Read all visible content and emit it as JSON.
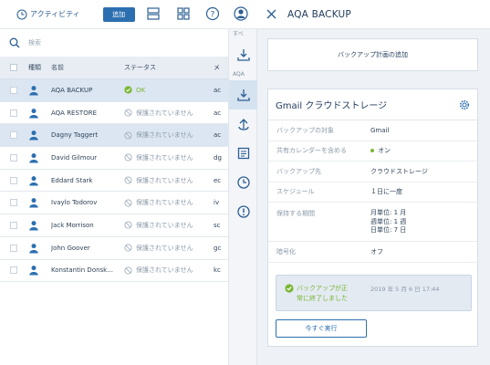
{
  "toolbar": {
    "activity_label": "アクティビティ",
    "add_label": "追加"
  },
  "search": {
    "placeholder": "検索"
  },
  "table": {
    "headers": {
      "kind": "種類",
      "name": "名前",
      "status": "ステータス",
      "extra": "メ"
    },
    "rows": [
      {
        "name": "AQA BACKUP",
        "status": "OK",
        "status_type": "ok",
        "extra": "ac",
        "selected": true
      },
      {
        "name": "AQA RESTORE",
        "status": "保護されていません",
        "status_type": "none",
        "extra": "ac",
        "selected": false
      },
      {
        "name": "Dagny Taggert",
        "status": "保護されていません",
        "status_type": "none",
        "extra": "ac",
        "selected": true
      },
      {
        "name": "David Gilmour",
        "status": "保護されていません",
        "status_type": "none",
        "extra": "dg",
        "selected": false
      },
      {
        "name": "Eddard Stark",
        "status": "保護されていません",
        "status_type": "none",
        "extra": "ec",
        "selected": false
      },
      {
        "name": "Ivaylo Todorov",
        "status": "保護されていません",
        "status_type": "none",
        "extra": "iv",
        "selected": false
      },
      {
        "name": "Jack Morrison",
        "status": "保護されていません",
        "status_type": "none",
        "extra": "sc",
        "selected": false
      },
      {
        "name": "John Goover",
        "status": "保護されていません",
        "status_type": "none",
        "extra": "gc",
        "selected": false
      },
      {
        "name": "Konstantin Donsk...",
        "status": "保護されていません",
        "status_type": "none",
        "extra": "kc",
        "selected": false
      }
    ]
  },
  "strip": {
    "label1": "すべ",
    "label2": "AQA"
  },
  "panel": {
    "title": "AQA BACKUP",
    "add_plan_label": "バックアップ計画の追加",
    "card_title": "Gmail クラウドストレージ",
    "fields": {
      "target_k": "バックアップの対象",
      "target_v": "Gmail",
      "calendar_k": "共有カレンダーを含める",
      "calendar_v": "オン",
      "dest_k": "バックアップ先",
      "dest_v": "クラウドストレージ",
      "sched_k": "スケジュール",
      "sched_v": "１日に一度",
      "retention_k": "保持する期間",
      "retention_v1": "月単位: 1 月",
      "retention_v2": "週単位: 1 週",
      "retention_v3": "日単位: 7 日",
      "encrypt_k": "暗号化",
      "encrypt_v": "オフ"
    },
    "status_msg1": "バックアップが正",
    "status_msg2": "常に終了しました",
    "status_time": "2019 年 5 月 6 日 17:44",
    "run_now_label": "今すぐ実行"
  },
  "colors": {
    "accent": "#2c6fb0",
    "ok": "#7ab632",
    "selected_row": "#dbe6f2"
  },
  "icons": [
    "clock-icon",
    "list-view-icon",
    "grid-view-icon",
    "help-icon",
    "account-icon",
    "search-icon",
    "user-icon",
    "check-circle-icon",
    "prohibited-icon",
    "close-icon",
    "gear-icon",
    "download-icon",
    "recovery-icon",
    "report-icon",
    "history-icon",
    "alert-icon"
  ]
}
